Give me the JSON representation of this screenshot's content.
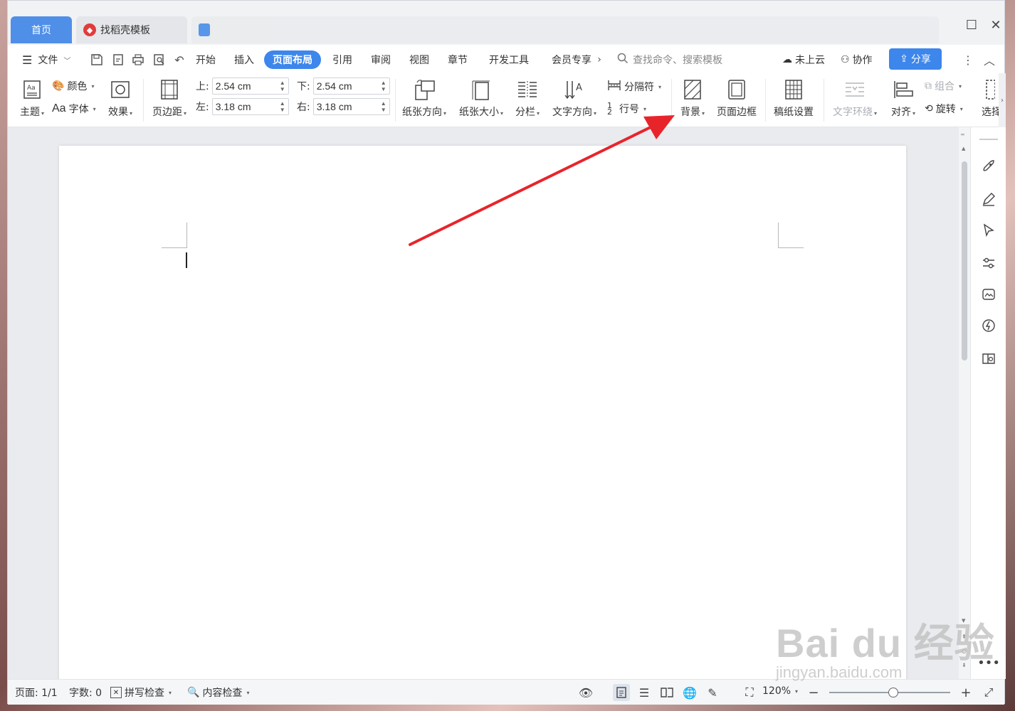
{
  "titlebar": {
    "tab_home": "首页",
    "tab_template": "找稻壳模板"
  },
  "menu": {
    "file": "文件",
    "items": [
      "开始",
      "插入",
      "页面布局",
      "引用",
      "审阅",
      "视图",
      "章节",
      "开发工具",
      "会员专享"
    ],
    "active": "页面布局",
    "search_placeholder": "查找命令、搜索模板",
    "cloud": "未上云",
    "collab": "协作",
    "share": "分享"
  },
  "ribbon": {
    "theme": "主题",
    "color": "颜色",
    "font": "字体",
    "font_prefix": "Aa",
    "effect": "效果",
    "margins": "页边距",
    "top_label": "上:",
    "top_value": "2.54 cm",
    "bottom_label": "下:",
    "bottom_value": "2.54 cm",
    "left_label": "左:",
    "left_value": "3.18 cm",
    "right_label": "右:",
    "right_value": "3.18 cm",
    "orientation": "纸张方向",
    "size": "纸张大小",
    "columns": "分栏",
    "text_direction": "文字方向",
    "breaks": "分隔符",
    "line_numbers": "行号",
    "background": "背景",
    "page_border": "页面边框",
    "manuscript": "稿纸设置",
    "text_wrap": "文字环绕",
    "align": "对齐",
    "group": "组合",
    "rotate": "旋转",
    "select": "选择"
  },
  "statusbar": {
    "page": "页面: 1/1",
    "words": "字数: 0",
    "spellcheck": "拼写检查",
    "content_check": "内容检查",
    "zoom": "120%",
    "zoom_level": 0.53
  },
  "watermark": {
    "main": "Bai du 经验",
    "sub": "jingyan.baidu.com"
  },
  "colors": {
    "accent": "#3d86eb",
    "arrow": "#e8242b"
  }
}
